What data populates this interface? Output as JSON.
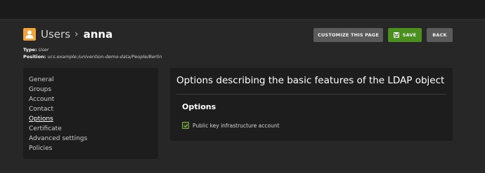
{
  "header": {
    "breadcrumb_parent": "Users",
    "breadcrumb_separator": "›",
    "breadcrumb_current": "anna",
    "type_label": "Type:",
    "type_value": "User",
    "position_label": "Position:",
    "position_value": "ucs.example:/univention-demo-data/People/Berlin"
  },
  "toolbar": {
    "customize_label": "CUSTOMIZE THIS PAGE",
    "save_label": "SAVE",
    "back_label": "BACK"
  },
  "sidebar": {
    "items": [
      {
        "label": "General"
      },
      {
        "label": "Groups"
      },
      {
        "label": "Account"
      },
      {
        "label": "Contact"
      },
      {
        "label": "Options",
        "active": true
      },
      {
        "label": "Certificate"
      },
      {
        "label": "Advanced settings"
      },
      {
        "label": "Policies"
      }
    ]
  },
  "main": {
    "title": "Options describing the basic features of the LDAP object",
    "section_title": "Options",
    "options": [
      {
        "label": "Public key infrastructure account",
        "checked": true
      }
    ]
  },
  "colors": {
    "accent_green": "#4b8f1e",
    "user_icon": "#f0a43a",
    "background": "#272727",
    "panel": "#1d1d1d"
  },
  "icons": {
    "header": "user-icon",
    "save": "save-icon",
    "checkbox": "check-icon"
  }
}
